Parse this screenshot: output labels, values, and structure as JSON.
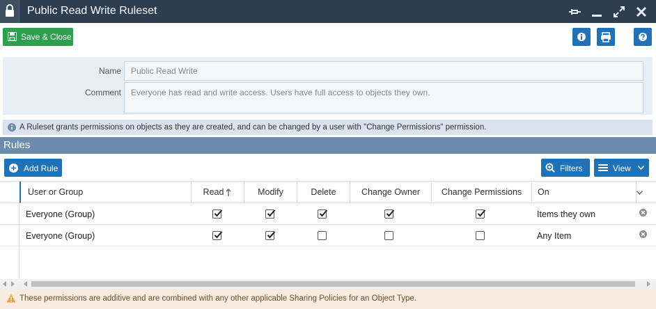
{
  "window": {
    "title": "Public Read Write Ruleset"
  },
  "toolbar": {
    "save_close_label": "Save & Close"
  },
  "form": {
    "name_label": "Name",
    "name_value": "Public Read Write",
    "comment_label": "Comment",
    "comment_value": "Everyone has read and write access. Users have full access to objects they own."
  },
  "info": {
    "text": "A Ruleset grants permissions on objects as they are created, and can be changed by a user with \"Change Permissions\" permission."
  },
  "rules": {
    "title": "Rules",
    "add_rule_label": "Add Rule",
    "filters_label": "Filters",
    "view_label": "View",
    "columns": [
      "User or Group",
      "Read",
      "Modify",
      "Delete",
      "Change Owner",
      "Change Permissions",
      "On"
    ],
    "rows": [
      {
        "user": "Everyone (Group)",
        "read": true,
        "modify": true,
        "delete": true,
        "change_owner": true,
        "change_permissions": true,
        "on": "Items they own"
      },
      {
        "user": "Everyone (Group)",
        "read": true,
        "modify": true,
        "delete": false,
        "change_owner": false,
        "change_permissions": false,
        "on": "Any Item"
      }
    ]
  },
  "warning": {
    "text": "These permissions are additive and are combined with any other applicable Sharing Policies for an Object Type."
  },
  "colors": {
    "titlebar": "#2c3e50",
    "save_green": "#2e9e4f",
    "primary_blue": "#1f72b8",
    "section_header": "#6b8cad",
    "warning_bg": "#f7ecdf"
  }
}
